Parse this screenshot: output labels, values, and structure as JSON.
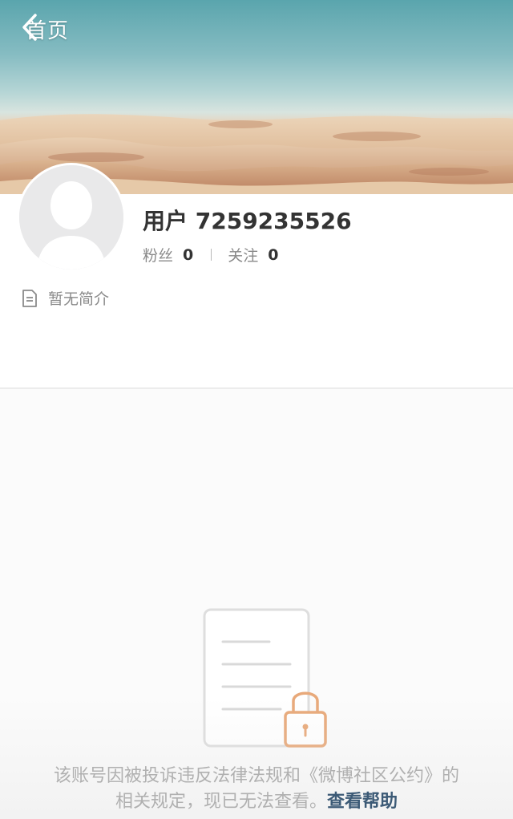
{
  "nav": {
    "back_label": "首页",
    "back_icon": "chevron-left-icon"
  },
  "profile": {
    "avatar_icon": "default-avatar-icon",
    "username": "用户 7259235526",
    "followers_label": "粉丝",
    "followers_count": "0",
    "following_label": "关注",
    "following_count": "0",
    "bio_icon": "document-icon",
    "bio_text": "暂无简介"
  },
  "notice": {
    "illustration_icon": "locked-document-icon",
    "message": "该账号因被投诉违反法律法规和《微博社区公约》的相关规定，现已无法查看。",
    "help_link": "查看帮助"
  },
  "colors": {
    "lock_accent": "#e8a97a",
    "help_link": "#3c5a76",
    "muted_text": "#8a8a8a"
  }
}
